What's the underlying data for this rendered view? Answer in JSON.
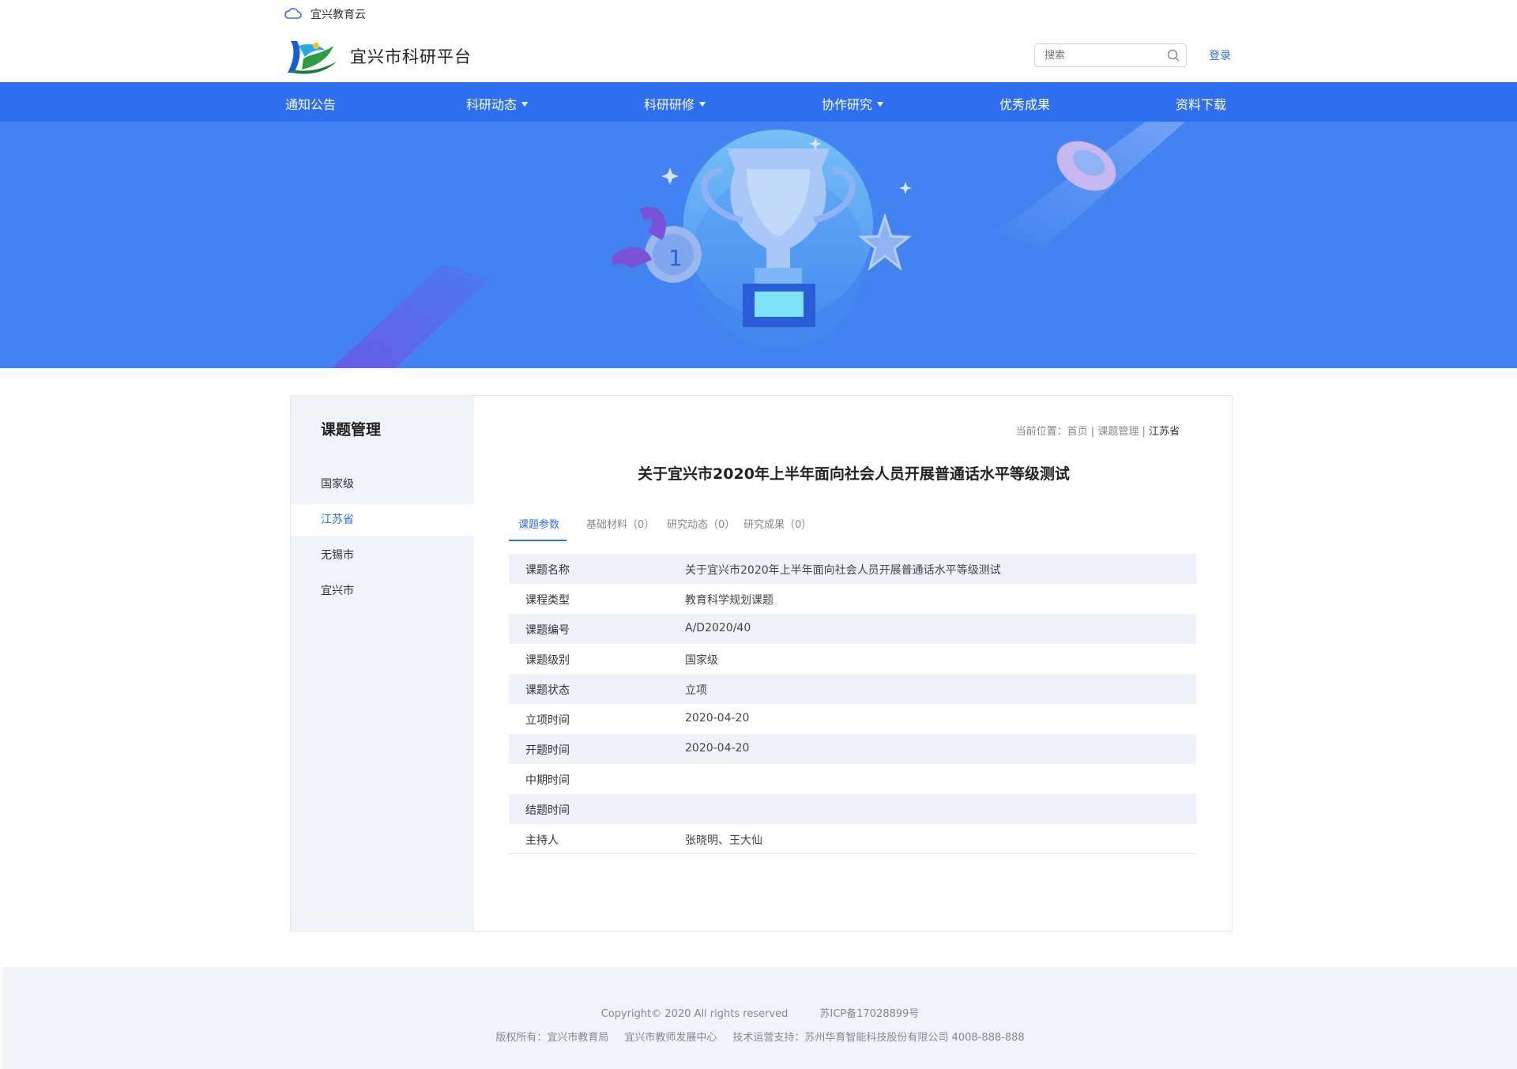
{
  "topbar": {
    "cloud_label": "宜兴教育云"
  },
  "header": {
    "site_title": "宜兴市科研平台",
    "search_placeholder": "搜索",
    "login_label": "登录"
  },
  "nav": {
    "items": [
      {
        "label": "通知公告"
      },
      {
        "label": "科研动态"
      },
      {
        "label": "科研研修"
      },
      {
        "label": "协作研究"
      },
      {
        "label": "优秀成果"
      },
      {
        "label": "资料下载"
      }
    ]
  },
  "sidebar": {
    "title": "课题管理",
    "items": [
      {
        "label": "国家级"
      },
      {
        "label": "江苏省"
      },
      {
        "label": "无锡市"
      },
      {
        "label": "宜兴市"
      }
    ],
    "active": "江苏省"
  },
  "breadcrumb": {
    "prefix": "当前位置：",
    "home": "首页",
    "section": "课题管理",
    "current": "江苏省"
  },
  "main": {
    "title": "关于宜兴市2020年上半年面向社会人员开展普通话水平等级测试",
    "tabs": [
      {
        "label": "课题参数"
      },
      {
        "label": "基础材料（0）"
      },
      {
        "label": "研究动态（0）"
      },
      {
        "label": "研究成果（0）"
      }
    ],
    "params": [
      {
        "key": "课题名称",
        "value": "关于宜兴市2020年上半年面向社会人员开展普通话水平等级测试"
      },
      {
        "key": "课程类型",
        "value": "教育科学规划课题"
      },
      {
        "key": "课题编号",
        "value": "A/D2020/40"
      },
      {
        "key": "课题级别",
        "value": "国家级"
      },
      {
        "key": "课题状态",
        "value": "立项"
      },
      {
        "key": "立项时间",
        "value": "2020-04-20"
      },
      {
        "key": "开题时间",
        "value": "2020-04-20"
      },
      {
        "key": "中期时间",
        "value": ""
      },
      {
        "key": "结题时间",
        "value": ""
      },
      {
        "key": "主持人",
        "value": "张晓明、王大仙"
      }
    ]
  },
  "footer": {
    "copyright": "Copyright© 2020 All rights reserved",
    "icp": "苏ICP备17028899号",
    "owner": "版权所有：宜兴市教育局",
    "center": "宜兴市教师发展中心",
    "support": "技术运营支持：苏州华育智能科技股份有限公司",
    "phone": "4008-888-888"
  },
  "colors": {
    "brand_blue": "#2e6ff0",
    "banner_blue": "#4283f1",
    "side_bg": "#eff3fa",
    "row_stripe": "#eef2fa"
  }
}
